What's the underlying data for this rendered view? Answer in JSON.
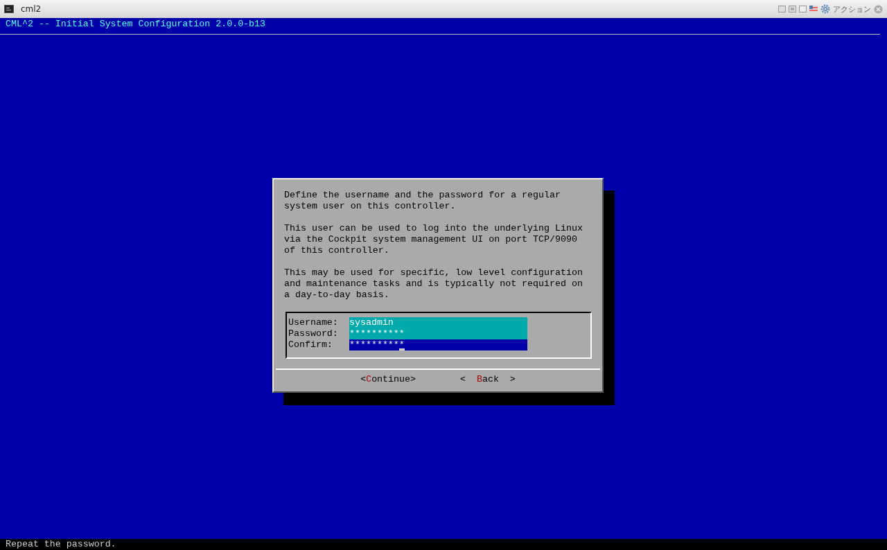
{
  "window": {
    "title": "cml2",
    "actions_label": "アクション"
  },
  "header": {
    "title": "CML^2 -- Initial System Configuration 2.0.0-b13"
  },
  "dialog": {
    "paragraphs": [
      "Define the username and the password for a regular\nsystem user on this controller.",
      "This user can be used to log into the underlying Linux\nvia the Cockpit system management UI on port TCP/9090\nof this controller.",
      "This may be used for specific, low level configuration\nand maintenance tasks and is typically not required on\na day-to-day basis."
    ],
    "fields": [
      {
        "label": "Username:",
        "value": "sysadmin",
        "focused": false
      },
      {
        "label": "Password:",
        "value": "**********",
        "focused": false
      },
      {
        "label": "Confirm:",
        "value": "**********",
        "focused": true
      }
    ],
    "buttons": [
      {
        "before": "<",
        "hotkey": "C",
        "after": "ontinue>"
      },
      {
        "before": "<  ",
        "hotkey": "B",
        "after": "ack  >"
      }
    ]
  },
  "status_bar": {
    "text": "Repeat the password."
  }
}
